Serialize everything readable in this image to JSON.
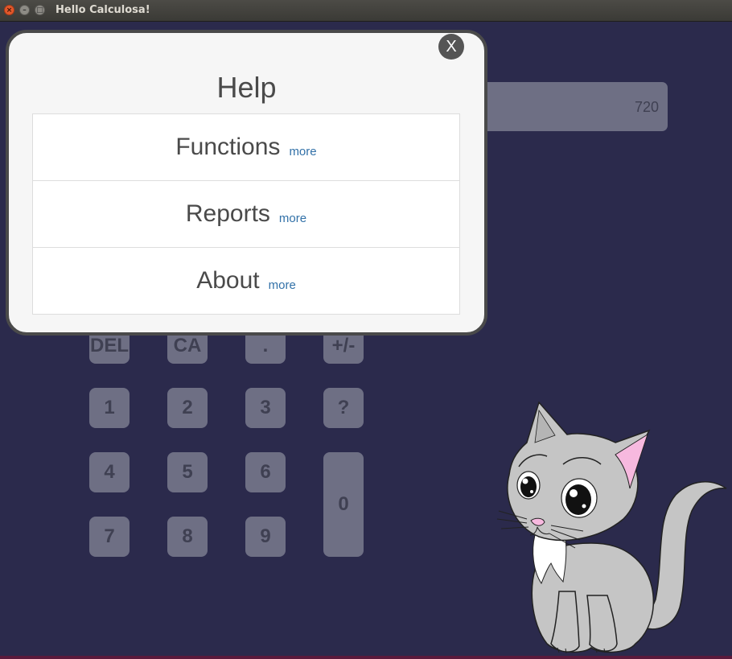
{
  "window": {
    "title": "Hello Calculosa!",
    "close_glyph": "×",
    "minimize_glyph": "–",
    "maximize_glyph": "□"
  },
  "display": {
    "value": "720"
  },
  "keypad": {
    "del": "DEL",
    "ca": "CA",
    "dot": ".",
    "sign": "+/-",
    "one": "1",
    "two": "2",
    "three": "3",
    "help": "?",
    "four": "4",
    "five": "5",
    "six": "6",
    "zero": "0",
    "seven": "7",
    "eight": "8",
    "nine": "9"
  },
  "help_modal": {
    "close_label": "X",
    "title": "Help",
    "items": [
      {
        "label": "Functions",
        "more": "more"
      },
      {
        "label": "Reports",
        "more": "more"
      },
      {
        "label": "About",
        "more": "more"
      }
    ]
  },
  "colors": {
    "background": "#2b2a4c",
    "key": "#6e6f84",
    "key_text": "#3f4052",
    "modal_background": "#f6f6f6",
    "link": "#3271a8"
  },
  "icons": {
    "mascot": "cat-mascot"
  }
}
